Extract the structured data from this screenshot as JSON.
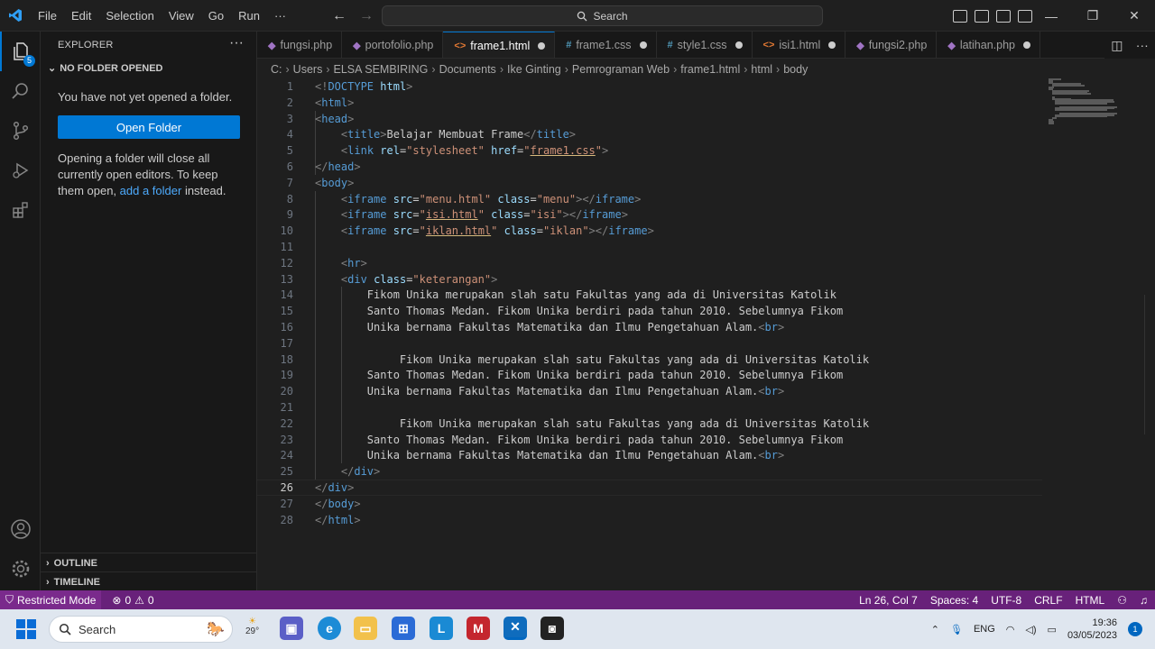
{
  "menu": [
    "File",
    "Edit",
    "Selection",
    "View",
    "Go",
    "Run",
    "···"
  ],
  "search": {
    "label": "Search"
  },
  "activity_badge": "5",
  "sidebar": {
    "title": "EXPLORER",
    "section": "NO FOLDER OPENED",
    "message": "You have not yet opened a folder.",
    "open_folder_label": "Open Folder",
    "note_before": "Opening a folder will close all currently open editors. To keep them open, ",
    "note_link": "add a folder",
    "note_after": " instead.",
    "outline_label": "OUTLINE",
    "timeline_label": "TIMELINE"
  },
  "tabs": [
    {
      "label": "fungsi.php",
      "icon": "php-icon",
      "active": false,
      "dirty": false
    },
    {
      "label": "portofolio.php",
      "icon": "php-icon",
      "active": false,
      "dirty": false
    },
    {
      "label": "frame1.html",
      "icon": "html-icon",
      "active": true,
      "dirty": true
    },
    {
      "label": "frame1.css",
      "icon": "css-icon",
      "active": false,
      "dirty": true
    },
    {
      "label": "style1.css",
      "icon": "css-icon",
      "active": false,
      "dirty": true
    },
    {
      "label": "isi1.html",
      "icon": "html-icon",
      "active": false,
      "dirty": true
    },
    {
      "label": "fungsi2.php",
      "icon": "php-icon",
      "active": false,
      "dirty": false
    },
    {
      "label": "latihan.php",
      "icon": "php-icon",
      "active": false,
      "dirty": true
    }
  ],
  "breadcrumb": [
    "C:",
    "Users",
    "ELSA  SEMBIRING",
    "Documents",
    "Ike Ginting",
    "Pemrograman Web",
    "frame1.html",
    "html",
    "body"
  ],
  "editor": {
    "current_line": 26,
    "lines": [
      [
        [
          "tag",
          "<!"
        ],
        [
          "tn",
          "DOCTYPE"
        ],
        [
          "tx",
          " "
        ],
        [
          "an",
          "html"
        ],
        [
          "tag",
          ">"
        ]
      ],
      [
        [
          "tag",
          "<"
        ],
        [
          "tn",
          "html"
        ],
        [
          "tag",
          ">"
        ]
      ],
      [
        [
          "tag",
          "<"
        ],
        [
          "tn",
          "head"
        ],
        [
          "tag",
          ">"
        ]
      ],
      [
        [
          "tx",
          "    "
        ],
        [
          "tag",
          "<"
        ],
        [
          "tn",
          "title"
        ],
        [
          "tag",
          ">"
        ],
        [
          "tx",
          "Belajar Membuat Frame"
        ],
        [
          "tag",
          "</"
        ],
        [
          "tn",
          "title"
        ],
        [
          "tag",
          ">"
        ]
      ],
      [
        [
          "tx",
          "    "
        ],
        [
          "tag",
          "<"
        ],
        [
          "tn",
          "link"
        ],
        [
          "tx",
          " "
        ],
        [
          "an",
          "rel"
        ],
        [
          "tx",
          "="
        ],
        [
          "av",
          "\"stylesheet\""
        ],
        [
          "tx",
          " "
        ],
        [
          "an",
          "href"
        ],
        [
          "tx",
          "="
        ],
        [
          "av",
          "\""
        ],
        [
          "avu",
          "frame1.css"
        ],
        [
          "av",
          "\""
        ],
        [
          "tag",
          ">"
        ]
      ],
      [
        [
          "tag",
          "</"
        ],
        [
          "tn",
          "head"
        ],
        [
          "tag",
          ">"
        ]
      ],
      [
        [
          "tag",
          "<"
        ],
        [
          "tn",
          "body"
        ],
        [
          "tag",
          ">"
        ]
      ],
      [
        [
          "tx",
          "    "
        ],
        [
          "tag",
          "<"
        ],
        [
          "tn",
          "iframe"
        ],
        [
          "tx",
          " "
        ],
        [
          "an",
          "src"
        ],
        [
          "tx",
          "="
        ],
        [
          "av",
          "\"menu.html\""
        ],
        [
          "tx",
          " "
        ],
        [
          "an",
          "class"
        ],
        [
          "tx",
          "="
        ],
        [
          "av",
          "\"menu\""
        ],
        [
          "tag",
          "></"
        ],
        [
          "tn",
          "iframe"
        ],
        [
          "tag",
          ">"
        ]
      ],
      [
        [
          "tx",
          "    "
        ],
        [
          "tag",
          "<"
        ],
        [
          "tn",
          "iframe"
        ],
        [
          "tx",
          " "
        ],
        [
          "an",
          "src"
        ],
        [
          "tx",
          "="
        ],
        [
          "av",
          "\""
        ],
        [
          "avu",
          "isi.html"
        ],
        [
          "av",
          "\""
        ],
        [
          "tx",
          " "
        ],
        [
          "an",
          "class"
        ],
        [
          "tx",
          "="
        ],
        [
          "av",
          "\"isi\""
        ],
        [
          "tag",
          "></"
        ],
        [
          "tn",
          "iframe"
        ],
        [
          "tag",
          ">"
        ]
      ],
      [
        [
          "tx",
          "    "
        ],
        [
          "tag",
          "<"
        ],
        [
          "tn",
          "iframe"
        ],
        [
          "tx",
          " "
        ],
        [
          "an",
          "src"
        ],
        [
          "tx",
          "="
        ],
        [
          "av",
          "\""
        ],
        [
          "avu",
          "iklan.html"
        ],
        [
          "av",
          "\""
        ],
        [
          "tx",
          " "
        ],
        [
          "an",
          "class"
        ],
        [
          "tx",
          "="
        ],
        [
          "av",
          "\"iklan\""
        ],
        [
          "tag",
          "></"
        ],
        [
          "tn",
          "iframe"
        ],
        [
          "tag",
          ">"
        ]
      ],
      [],
      [
        [
          "tx",
          "    "
        ],
        [
          "tag",
          "<"
        ],
        [
          "tn",
          "hr"
        ],
        [
          "tag",
          ">"
        ]
      ],
      [
        [
          "tx",
          "    "
        ],
        [
          "tag",
          "<"
        ],
        [
          "tn",
          "div"
        ],
        [
          "tx",
          " "
        ],
        [
          "an",
          "class"
        ],
        [
          "tx",
          "="
        ],
        [
          "av",
          "\"keterangan\""
        ],
        [
          "tag",
          ">"
        ]
      ],
      [
        [
          "tx",
          "        Fikom Unika merupakan slah satu Fakultas yang ada di Universitas Katolik"
        ]
      ],
      [
        [
          "tx",
          "        Santo Thomas Medan. Fikom Unika berdiri pada tahun 2010. Sebelumnya Fikom"
        ]
      ],
      [
        [
          "tx",
          "        Unika bernama Fakultas Matematika dan Ilmu Pengetahuan Alam."
        ],
        [
          "tag",
          "<"
        ],
        [
          "tn",
          "br"
        ],
        [
          "tag",
          ">"
        ]
      ],
      [],
      [
        [
          "tx",
          "             Fikom Unika merupakan slah satu Fakultas yang ada di Universitas Katolik"
        ]
      ],
      [
        [
          "tx",
          "        Santo Thomas Medan. Fikom Unika berdiri pada tahun 2010. Sebelumnya Fikom"
        ]
      ],
      [
        [
          "tx",
          "        Unika bernama Fakultas Matematika dan Ilmu Pengetahuan Alam."
        ],
        [
          "tag",
          "<"
        ],
        [
          "tn",
          "br"
        ],
        [
          "tag",
          ">"
        ]
      ],
      [],
      [
        [
          "tx",
          "             Fikom Unika merupakan slah satu Fakultas yang ada di Universitas Katolik"
        ]
      ],
      [
        [
          "tx",
          "        Santo Thomas Medan. Fikom Unika berdiri pada tahun 2010. Sebelumnya Fikom"
        ]
      ],
      [
        [
          "tx",
          "        Unika bernama Fakultas Matematika dan Ilmu Pengetahuan Alam."
        ],
        [
          "tag",
          "<"
        ],
        [
          "tn",
          "br"
        ],
        [
          "tag",
          ">"
        ]
      ],
      [
        [
          "tx",
          "    "
        ],
        [
          "tag",
          "</"
        ],
        [
          "tn",
          "div"
        ],
        [
          "tag",
          ">"
        ]
      ],
      [
        [
          "tag",
          "</"
        ],
        [
          "tn",
          "div"
        ],
        [
          "tag",
          ">"
        ]
      ],
      [
        [
          "tag",
          "</"
        ],
        [
          "tn",
          "body"
        ],
        [
          "tag",
          ">"
        ]
      ],
      [
        [
          "tag",
          "</"
        ],
        [
          "tn",
          "html"
        ],
        [
          "tag",
          ">"
        ]
      ]
    ]
  },
  "status": {
    "restricted": "Restricted Mode",
    "errors": "0",
    "warnings": "0",
    "position": "Ln 26, Col 7",
    "spaces": "Spaces: 4",
    "encoding": "UTF-8",
    "eol": "CRLF",
    "language": "HTML"
  },
  "taskbar": {
    "search": "Search",
    "weather": "29°",
    "lang": "ENG",
    "time": "19:36",
    "date": "03/05/2023",
    "notifications": "1"
  },
  "colors": {
    "accent": "#0078d4",
    "statusbar": "#68217a",
    "tag_name": "#569cd6",
    "attr_name": "#9cdcfe",
    "attr_value": "#ce9178"
  }
}
